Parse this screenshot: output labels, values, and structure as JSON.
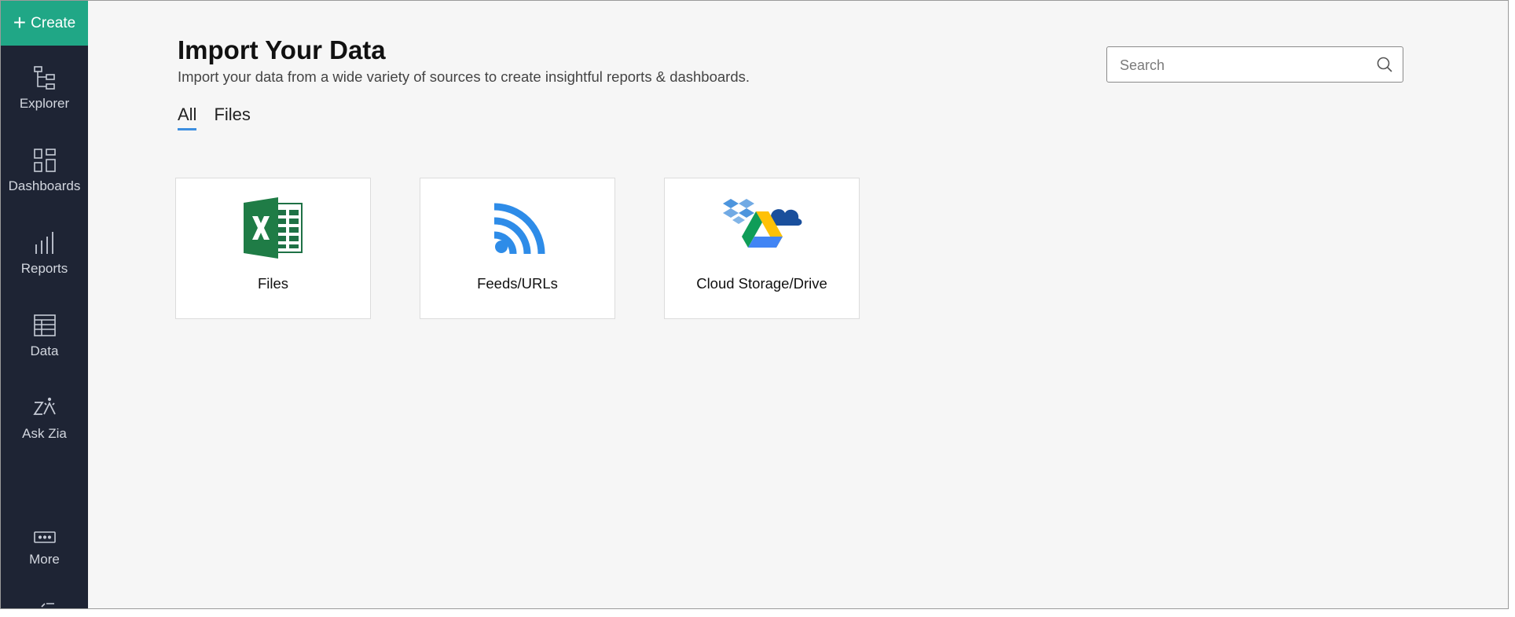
{
  "sidebar": {
    "create_label": "Create",
    "items": [
      {
        "label": "Explorer",
        "icon": "explorer-icon"
      },
      {
        "label": "Dashboards",
        "icon": "dashboards-icon"
      },
      {
        "label": "Reports",
        "icon": "reports-icon"
      },
      {
        "label": "Data",
        "icon": "data-table-icon"
      },
      {
        "label": "Ask Zia",
        "icon": "ask-zia-icon"
      },
      {
        "label": "More",
        "icon": "more-icon"
      }
    ]
  },
  "header": {
    "title": "Import Your Data",
    "subtitle": "Import your data from a wide variety of sources to create insightful reports & dashboards."
  },
  "search": {
    "placeholder": "Search",
    "value": ""
  },
  "tabs": [
    {
      "label": "All",
      "active": true
    },
    {
      "label": "Files",
      "active": false
    }
  ],
  "cards": [
    {
      "label": "Files",
      "icon": "excel-icon"
    },
    {
      "label": "Feeds/URLs",
      "icon": "rss-feed-icon"
    },
    {
      "label": "Cloud Storage/Drive",
      "icon": "cloud-storage-icon"
    }
  ],
  "colors": {
    "sidebar_bg": "#1e2434",
    "create_bg": "#20a786",
    "tab_accent": "#3d8fe0",
    "page_bg": "#f6f6f6"
  }
}
